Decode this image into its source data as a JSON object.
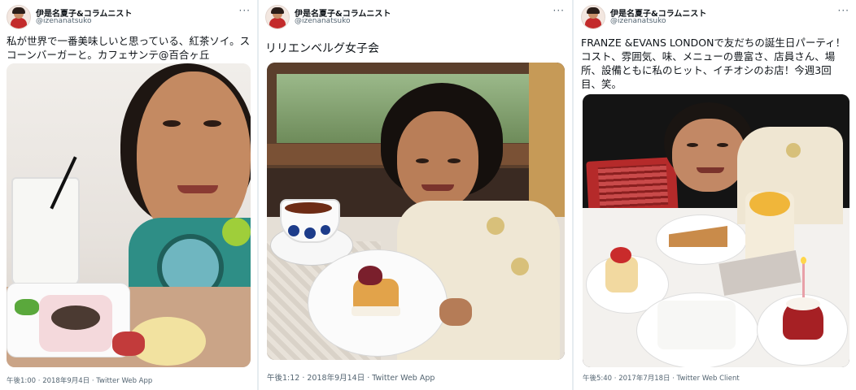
{
  "tweets": [
    {
      "user": {
        "name": "伊是名夏子&コラムニスト",
        "handle": "@izenanatsuko"
      },
      "more": "···",
      "text": "私が世界で一番美味しいと思っている、紅茶ソイ。スコーンバーガーと。カフェサンテ@百合ヶ丘",
      "timestamp": "午後1:00 · 2018年9月4日 · Twitter Web App"
    },
    {
      "user": {
        "name": "伊是名夏子&コラムニスト",
        "handle": "@izenanatsuko"
      },
      "more": "···",
      "text": "リリエンベルグ女子会",
      "timestamp": "午後1:12 · 2018年9月14日 · Twitter Web App"
    },
    {
      "user": {
        "name": "伊是名夏子&コラムニスト",
        "handle": "@izenanatsuko"
      },
      "more": "···",
      "text": "FRANZE &EVANS LONDONで友だちの誕生日パーティ！コスト、雰囲気、味、メニューの豊富さ、店員さん、場所、設備ともに私のヒット、イチオシのお店！今週3回目、笑。",
      "timestamp": "午後5:40 · 2017年7月18日 · Twitter Web Client"
    }
  ],
  "icons": {
    "avatar": "avatar-portrait",
    "more": "more-dots-icon",
    "photo": "photo-attachment"
  }
}
